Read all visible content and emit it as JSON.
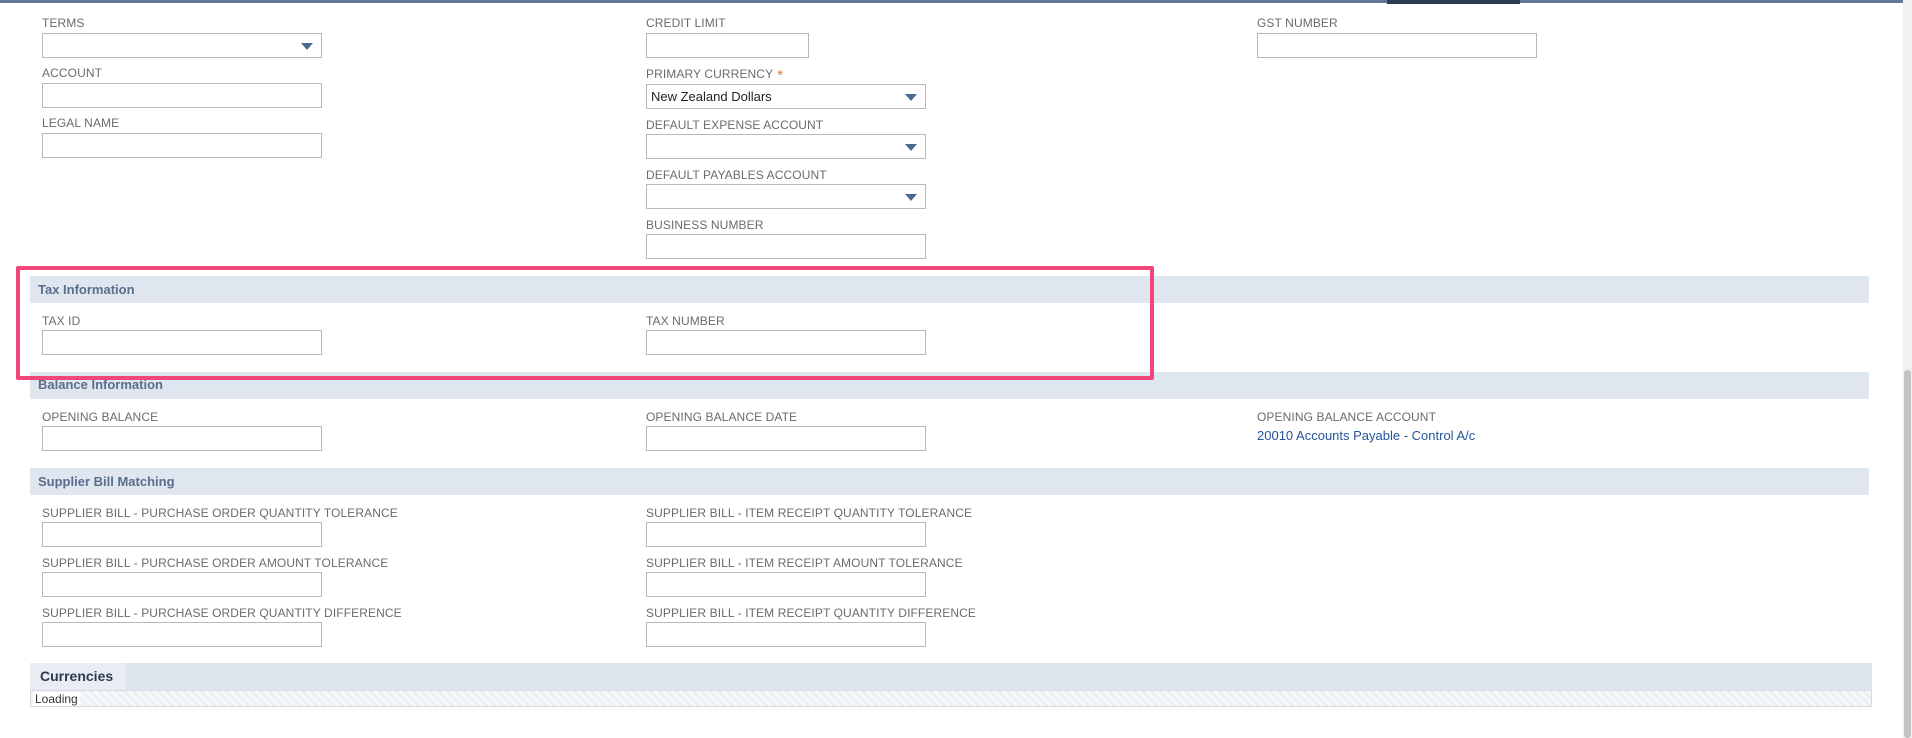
{
  "form": {
    "terms": {
      "label": "TERMS",
      "value": ""
    },
    "account": {
      "label": "ACCOUNT",
      "value": ""
    },
    "legal_name": {
      "label": "LEGAL NAME",
      "value": ""
    },
    "credit_limit": {
      "label": "CREDIT LIMIT",
      "value": ""
    },
    "primary_currency": {
      "label": "PRIMARY CURRENCY",
      "required_mark": "*",
      "value": "New Zealand Dollars"
    },
    "default_expense_account": {
      "label": "DEFAULT EXPENSE ACCOUNT",
      "value": ""
    },
    "default_payables_account": {
      "label": "DEFAULT PAYABLES ACCOUNT",
      "value": ""
    },
    "business_number": {
      "label": "BUSINESS NUMBER",
      "value": ""
    },
    "gst_number": {
      "label": "GST NUMBER",
      "value": ""
    }
  },
  "tax_section": {
    "title": "Tax Information",
    "tax_id": {
      "label": "TAX ID",
      "value": ""
    },
    "tax_number": {
      "label": "TAX NUMBER",
      "value": ""
    }
  },
  "balance_section": {
    "title": "Balance Information",
    "opening_balance": {
      "label": "OPENING BALANCE",
      "value": ""
    },
    "opening_balance_date": {
      "label": "OPENING BALANCE DATE",
      "value": ""
    },
    "opening_balance_account": {
      "label": "OPENING BALANCE ACCOUNT",
      "value": "20010 Accounts Payable - Control A/c"
    }
  },
  "matching_section": {
    "title": "Supplier Bill Matching",
    "po_qty_tolerance": {
      "label": "SUPPLIER BILL - PURCHASE ORDER QUANTITY TOLERANCE",
      "value": ""
    },
    "po_amount_tolerance": {
      "label": "SUPPLIER BILL - PURCHASE ORDER AMOUNT TOLERANCE",
      "value": ""
    },
    "po_qty_difference": {
      "label": "SUPPLIER BILL - PURCHASE ORDER QUANTITY DIFFERENCE",
      "value": ""
    },
    "ir_qty_tolerance": {
      "label": "SUPPLIER BILL - ITEM RECEIPT QUANTITY TOLERANCE",
      "value": ""
    },
    "ir_amount_tolerance": {
      "label": "SUPPLIER BILL - ITEM RECEIPT AMOUNT TOLERANCE",
      "value": ""
    },
    "ir_qty_difference": {
      "label": "SUPPLIER BILL - ITEM RECEIPT QUANTITY DIFFERENCE",
      "value": ""
    }
  },
  "currencies_tab": {
    "label": "Currencies",
    "status": "Loading"
  },
  "colors": {
    "section_bg": "#e0e6ef",
    "section_title": "#5a6e8c",
    "link": "#255599",
    "highlight": "#f0477a",
    "required": "#e07b39"
  },
  "icons": {
    "dropdown": "caret-down-icon"
  }
}
